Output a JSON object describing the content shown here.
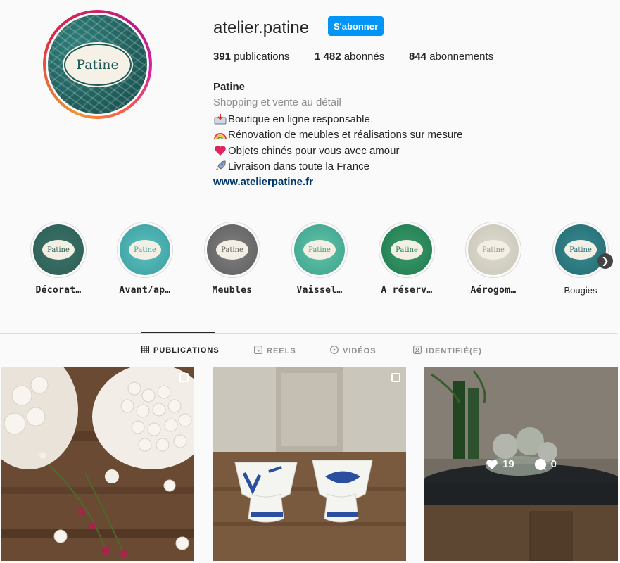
{
  "profile": {
    "username": "atelier.patine",
    "follow_label": "S'abonner",
    "avatar_text": "Patine",
    "stats": {
      "posts_count": "391",
      "posts_label": "publications",
      "followers_count": "1 482",
      "followers_label": "abonnés",
      "following_count": "844",
      "following_label": "abonnements"
    },
    "bio": {
      "name": "Patine",
      "category": "Shopping et vente au détail",
      "lines": [
        {
          "icon": "inbox-tray-icon",
          "text": "Boutique en ligne responsable"
        },
        {
          "icon": "rainbow-icon",
          "text": "Rénovation de meubles et réalisations sur mesure"
        },
        {
          "icon": "heart-icon",
          "text": "Objets chinés pour vous avec amour"
        },
        {
          "icon": "rocket-icon",
          "text": "Livraison dans toute la France"
        }
      ],
      "website": "www.atelierpatine.fr"
    }
  },
  "highlights": [
    {
      "label": "Décorat…",
      "oval_text": "Patine",
      "color": "#2c5f55"
    },
    {
      "label": "Avant/ap…",
      "oval_text": "Patine",
      "color": "#3a9ea0"
    },
    {
      "label": "Meubles",
      "oval_text": "Patine",
      "color": "#5e5e5e"
    },
    {
      "label": "Vaissel…",
      "oval_text": "Patine",
      "color": "#3aa38a"
    },
    {
      "label": "A réserv…",
      "oval_text": "Patine",
      "color": "#1e7a4f"
    },
    {
      "label": "Aérogom…",
      "oval_text": "Patine",
      "color": "#c9c6b8"
    },
    {
      "label": "Bougies",
      "oval_text": "Patine",
      "color": "#236b72"
    }
  ],
  "tabs": [
    {
      "label": "PUBLICATIONS",
      "icon": "grid-icon",
      "active": true
    },
    {
      "label": "REELS",
      "icon": "reels-icon",
      "active": false
    },
    {
      "label": "VIDÉOS",
      "icon": "video-play-icon",
      "active": false
    },
    {
      "label": "IDENTIFIÉ(E)",
      "icon": "tagged-icon",
      "active": false
    }
  ],
  "posts": [
    {
      "subject": "meringues",
      "multi": true
    },
    {
      "subject": "egg-cups",
      "multi": true
    },
    {
      "subject": "hydrangea-bowl",
      "likes": "19",
      "comments": "0"
    }
  ],
  "colors": {
    "accent": "#0095f6",
    "link": "#00376b",
    "brand_teal": "#1d5a57"
  }
}
